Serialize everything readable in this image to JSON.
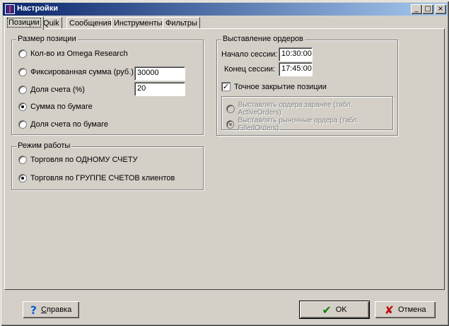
{
  "window": {
    "title": "Настройки"
  },
  "titlebar_buttons": {
    "minimize": "_",
    "maximize": "□",
    "close": "×"
  },
  "tabs": [
    "Позиции",
    "Quik",
    "Сообщения",
    "Инструменты",
    "Фильтры"
  ],
  "position_size": {
    "legend": "Размер позиции",
    "options": [
      {
        "label": "Кол-во из Omega Research",
        "checked": false
      },
      {
        "label": "Фиксированная сумма (руб.)",
        "checked": false
      },
      {
        "label": "Доля счета (%)",
        "checked": false
      },
      {
        "label": "Сумма по бумаге",
        "checked": true
      },
      {
        "label": "Доля счета по бумаге",
        "checked": false
      }
    ],
    "fixed_sum_value": "30000",
    "share_value": "20"
  },
  "mode": {
    "legend": "Режим работы",
    "options": [
      {
        "label": "Торговля по ОДНОМУ СЧЕТУ",
        "checked": false
      },
      {
        "label": "Торговля по ГРУППЕ СЧЕТОВ клиентов",
        "checked": true
      }
    ]
  },
  "orders": {
    "legend": "Выставление ордеров",
    "session_start_label": "Начало сессии:",
    "session_start_value": "10:30:00",
    "session_end_label": "Конец сессии:",
    "session_end_value": "17:45:00",
    "exact_close_label": "Точное закрытие позиции",
    "exact_close_checked": true,
    "sub_options": [
      {
        "label": "Выставлять ордера заранее (табл. ActiveOrders)",
        "checked": false
      },
      {
        "label": "Выставлять рыночные ордера (табл. FilledOrders)",
        "checked": true
      }
    ]
  },
  "buttons": {
    "help_underlined": "С",
    "help_rest": "правка",
    "ok": "OK",
    "cancel": "Отмена"
  },
  "colors": {
    "title_start": "#0a246a",
    "title_end": "#a6caf0",
    "help_icon": "#1060d0",
    "ok_icon": "#108010",
    "cancel_icon": "#c01010"
  }
}
